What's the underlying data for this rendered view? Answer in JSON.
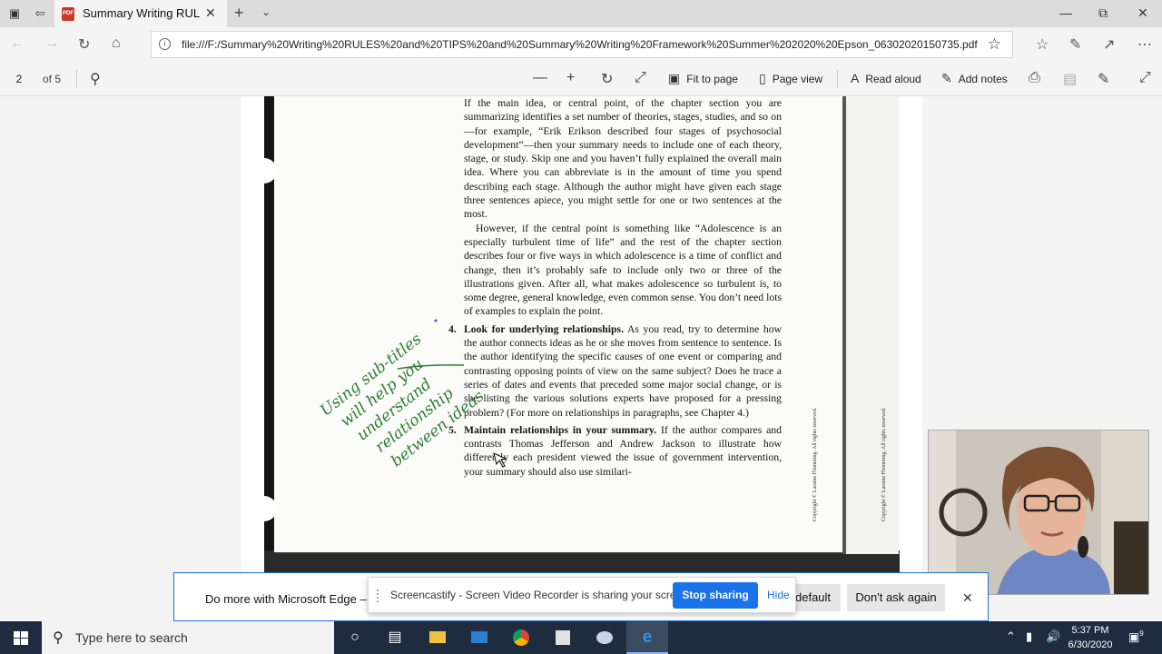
{
  "browser": {
    "tab_title": "Summary Writing RULES",
    "tab_icon_text": "PDF",
    "address": "file:///F:/Summary%20Writing%20RULES%20and%20TIPS%20and%20Summary%20Writing%20Framework%20Summer%202020%20Epson_06302020150735.pdf"
  },
  "pdf_toolbar": {
    "page_number": "2",
    "page_of": "of 5",
    "fit_to_page": "Fit to page",
    "page_view": "Page view",
    "read_aloud": "Read aloud",
    "add_notes": "Add notes"
  },
  "document": {
    "para1": "If the main idea, or central point, of the chapter section you are summarizing identifies a set number of theories, stages, studies, and so on—for example, “Erik Erikson described four stages of psychosocial development”—then your summary needs to include one of each theory, stage, or study. Skip one and you haven’t fully explained the overall main idea. Where you can abbreviate is in the amount of time you spend describing each stage. Although the author might have given each stage three sentences apiece, you might settle for one or two sentences at the most.",
    "para2": "However, if the central point is something like “Adolescence is an especially turbulent time of life” and the rest of the chapter section describes four or five ways in which adolescence is a time of conflict and change, then it’s probably safe to include only two or three of the illustrations given. After all, what makes adolescence so turbulent is, to some degree, general knowledge, even common sense. You don’t need lots of examples to explain the point.",
    "item4_num": "4.",
    "item4_head": "Look for underlying relationships.",
    "item4_body": " As you read, try to determine how the author connects ideas as he or she moves from sentence to sentence. Is the author identifying the specific causes of one event or comparing and contrasting opposing points of view on the same subject? Does he trace a series of dates and events that preceded some major social change, or is she listing the various solutions experts have proposed for a pressing problem? (For more on relationships in paragraphs, see Chapter 4.)",
    "item5_num": "5.",
    "item5_head": "Maintain relationships in your summary.",
    "item5_body": " If the author compares and contrasts Thomas Jefferson and Andrew Jackson to illustrate how differently each president viewed the issue of government intervention, your summary should also use similari-",
    "copyright_1": "Copyright © Laraine Flemming. All rights reserved.",
    "copyright_2": "Copyright © Laraine Flemming. All rights reserved.",
    "handwriting_lines": [
      "Using sub-titles",
      "will help you",
      "understand",
      "relationship",
      "between ideas"
    ],
    "handwriting_color": "#2e7d32"
  },
  "edge_notification": {
    "message": "Do more with Microsoft Edge –",
    "default_button": "default",
    "dont_ask_button": "Don't ask again"
  },
  "screencastify": {
    "message": "Screencastify - Screen Video Recorder is sharing your screen.",
    "stop_button": "Stop sharing",
    "hide_link": "Hide"
  },
  "taskbar": {
    "search_placeholder": "Type here to search",
    "time": "5:37 PM",
    "date": "6/30/2020",
    "notification_count": "9"
  },
  "colors": {
    "accent": "#1a73e8",
    "taskbar": "#1f2c3f",
    "pdf_icon": "#c8392b"
  }
}
